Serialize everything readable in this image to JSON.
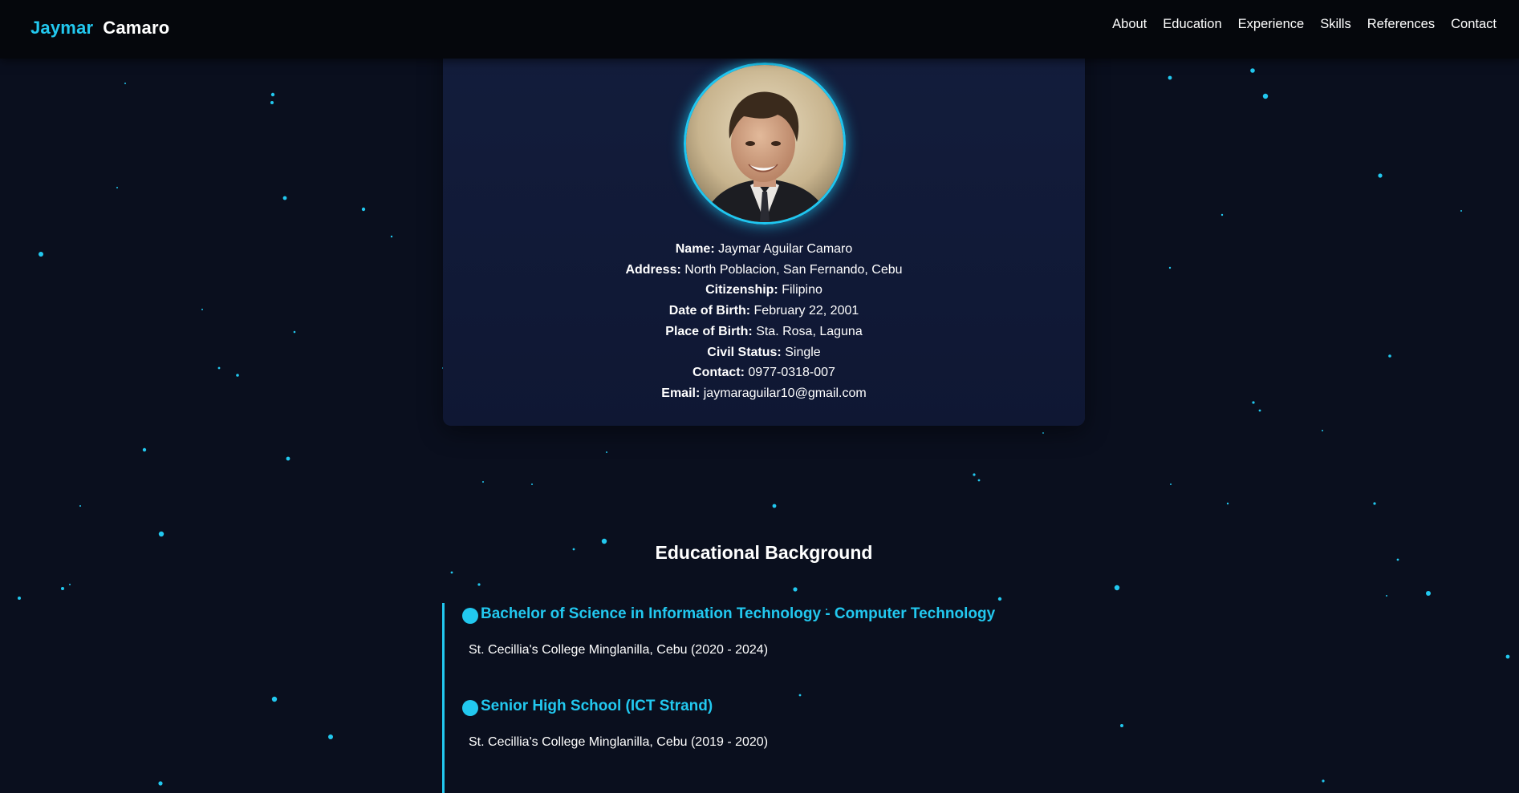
{
  "nav": {
    "brand_first": "Jaymar",
    "brand_last": "Camaro",
    "links": [
      "About",
      "Education",
      "Experience",
      "Skills",
      "References",
      "Contact"
    ]
  },
  "about": {
    "rows": [
      {
        "key": "Name:",
        "value": "Jaymar Aguilar Camaro"
      },
      {
        "key": "Address:",
        "value": "North Poblacion, San Fernando, Cebu"
      },
      {
        "key": "Citizenship:",
        "value": "Filipino"
      },
      {
        "key": "Date of Birth:",
        "value": "February 22, 2001"
      },
      {
        "key": "Place of Birth:",
        "value": "Sta. Rosa, Laguna"
      },
      {
        "key": "Civil Status:",
        "value": "Single"
      },
      {
        "key": "Contact:",
        "value": "0977-0318-007"
      },
      {
        "key": "Email:",
        "value": "jaymaraguilar10@gmail.com"
      }
    ]
  },
  "education": {
    "title": "Educational Background",
    "items": [
      {
        "degree": "Bachelor of Science in Information Technology - Computer Technology",
        "school": "St. Cecillia's College Minglanilla, Cebu (2020 - 2024)"
      },
      {
        "degree": "Senior High School (ICT Strand)",
        "school": "St. Cecillia's College Minglanilla, Cebu (2019 - 2020)"
      }
    ]
  },
  "colors": {
    "accent": "#22c8ef",
    "background": "#0a0f1e",
    "card": "#111a38",
    "nav_bg": "#05070c"
  }
}
